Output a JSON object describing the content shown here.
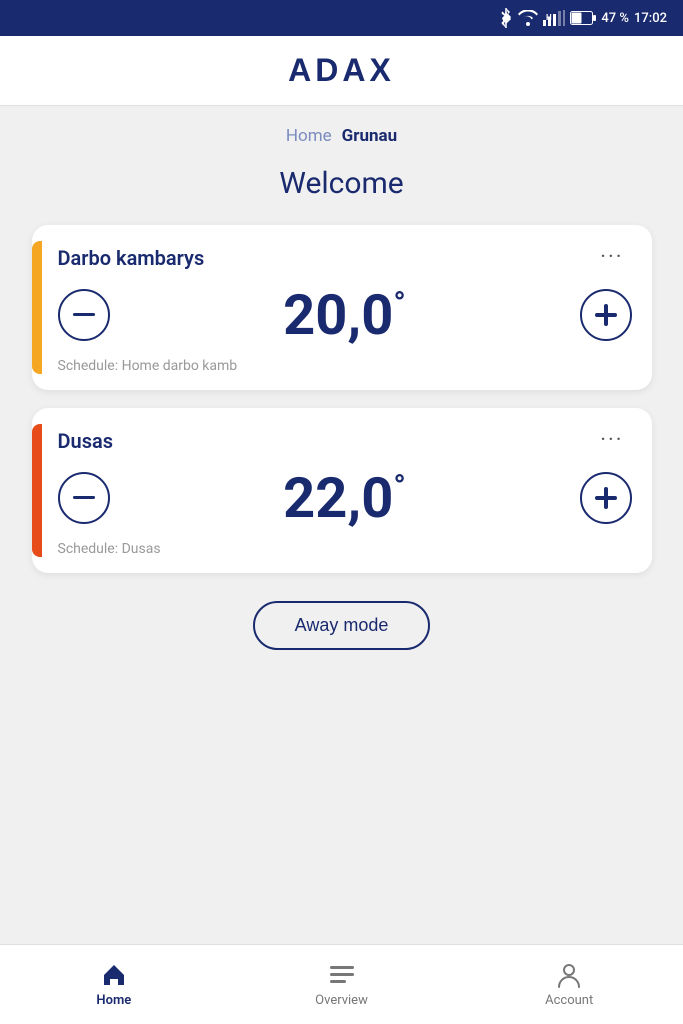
{
  "statusBar": {
    "battery": "47 %",
    "time": "17:02"
  },
  "header": {
    "logo": "ADAX"
  },
  "breadcrumb": {
    "inactive": "Home",
    "active": "Grunau"
  },
  "welcome": "Welcome",
  "cards": [
    {
      "id": "card-1",
      "name": "Darbo kambarys",
      "temperature": "20,0",
      "unit": "°",
      "schedule": "Schedule: Home darbo kamb",
      "indicator": "yellow"
    },
    {
      "id": "card-2",
      "name": "Dusas",
      "temperature": "22,0",
      "unit": "°",
      "schedule": "Schedule: Dusas",
      "indicator": "orange"
    }
  ],
  "awayModeBtn": "Away mode",
  "bottomNav": [
    {
      "id": "home",
      "label": "Home",
      "active": true
    },
    {
      "id": "overview",
      "label": "Overview",
      "active": false
    },
    {
      "id": "account",
      "label": "Account",
      "active": false
    }
  ]
}
